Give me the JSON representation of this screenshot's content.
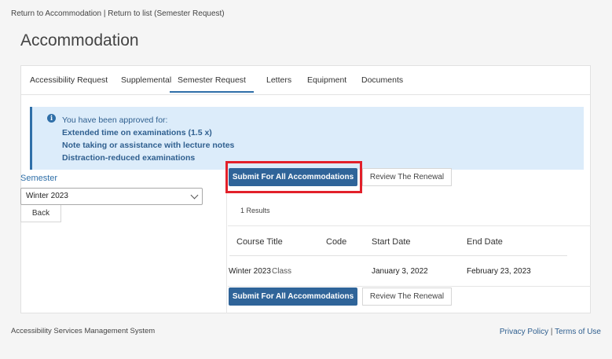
{
  "breadcrumb": {
    "back_accommodation": "Return to Accommodation",
    "separator": " | ",
    "back_list": "Return to list (Semester Request)"
  },
  "page": {
    "title": "Accommodation"
  },
  "tabs": [
    {
      "label": "Accessibility Request",
      "active": false
    },
    {
      "label": "Supplemental",
      "active": false
    },
    {
      "label": "Semester Request",
      "active": true
    },
    {
      "label": "Letters",
      "active": false
    },
    {
      "label": "Equipment",
      "active": false
    },
    {
      "label": "Documents",
      "active": false
    }
  ],
  "info": {
    "icon": "info-icon",
    "lead": "You have been approved for:",
    "items": [
      "Extended time on examinations (1.5 x)",
      "Note taking or assistance with lecture notes",
      "Distraction-reduced examinations"
    ]
  },
  "semester": {
    "label": "Semester",
    "selected": "Winter 2023",
    "back_label": "Back"
  },
  "actions": {
    "submit_all": "Submit For All Accommodations",
    "review_renewal": "Review The Renewal"
  },
  "results": {
    "count_text": "1 Results",
    "columns": [
      "Course Title",
      "Code",
      "Start Date",
      "End Date"
    ],
    "rows": [
      {
        "title_term": "Winter 2023",
        "title_type": "Class",
        "code": "",
        "start": "January 3, 2022",
        "end": "February 23, 2023"
      }
    ]
  },
  "footer": {
    "system_name": "Accessibility Services Management System",
    "privacy": "Privacy Policy",
    "separator": " | ",
    "terms": "Terms of Use"
  },
  "colors": {
    "accent": "#2f6499",
    "highlight": "#e2202a",
    "info_bg": "#dcecfa"
  }
}
